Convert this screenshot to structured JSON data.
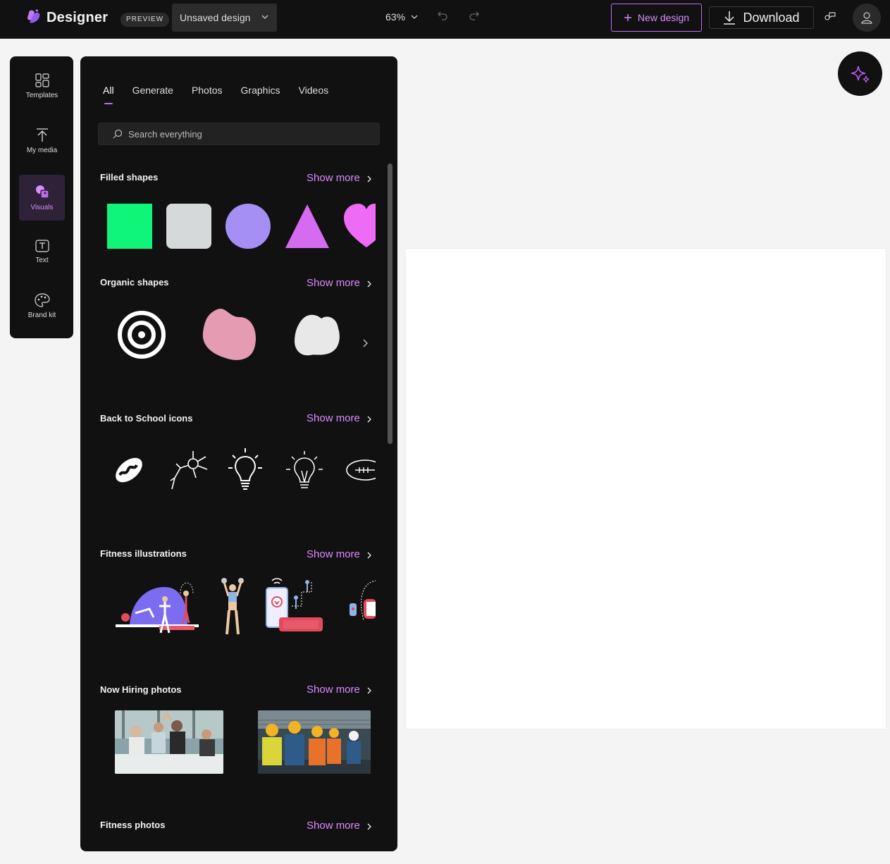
{
  "topbar": {
    "app_name": "Designer",
    "badge": "PREVIEW",
    "design_name": "Unsaved design",
    "zoom": "63%",
    "new_design": "New design",
    "download": "Download"
  },
  "rail": {
    "items": [
      {
        "label": "Templates",
        "icon": "templates-icon"
      },
      {
        "label": "My media",
        "icon": "upload-icon"
      },
      {
        "label": "Visuals",
        "icon": "visuals-icon",
        "active": true
      },
      {
        "label": "Text",
        "icon": "text-icon"
      },
      {
        "label": "Brand kit",
        "icon": "palette-icon"
      }
    ]
  },
  "panel": {
    "tabs": [
      "All",
      "Generate",
      "Photos",
      "Graphics",
      "Videos"
    ],
    "active_tab": "All",
    "search_placeholder": "Search everything",
    "show_more": "Show more",
    "sections": [
      {
        "title": "Filled shapes"
      },
      {
        "title": "Organic shapes"
      },
      {
        "title": "Back to School icons"
      },
      {
        "title": "Fitness illustrations"
      },
      {
        "title": "Now Hiring photos"
      },
      {
        "title": "Fitness photos"
      }
    ]
  },
  "colors": {
    "accent": "#c26bf0",
    "shape_green": "#0ff57a",
    "shape_gray": "#d5d9d9",
    "shape_violet": "#a68ff4",
    "shape_triangle": "#d56bf0",
    "shape_heart": "#ee6bf6",
    "organic_pink": "#e59bb2"
  }
}
